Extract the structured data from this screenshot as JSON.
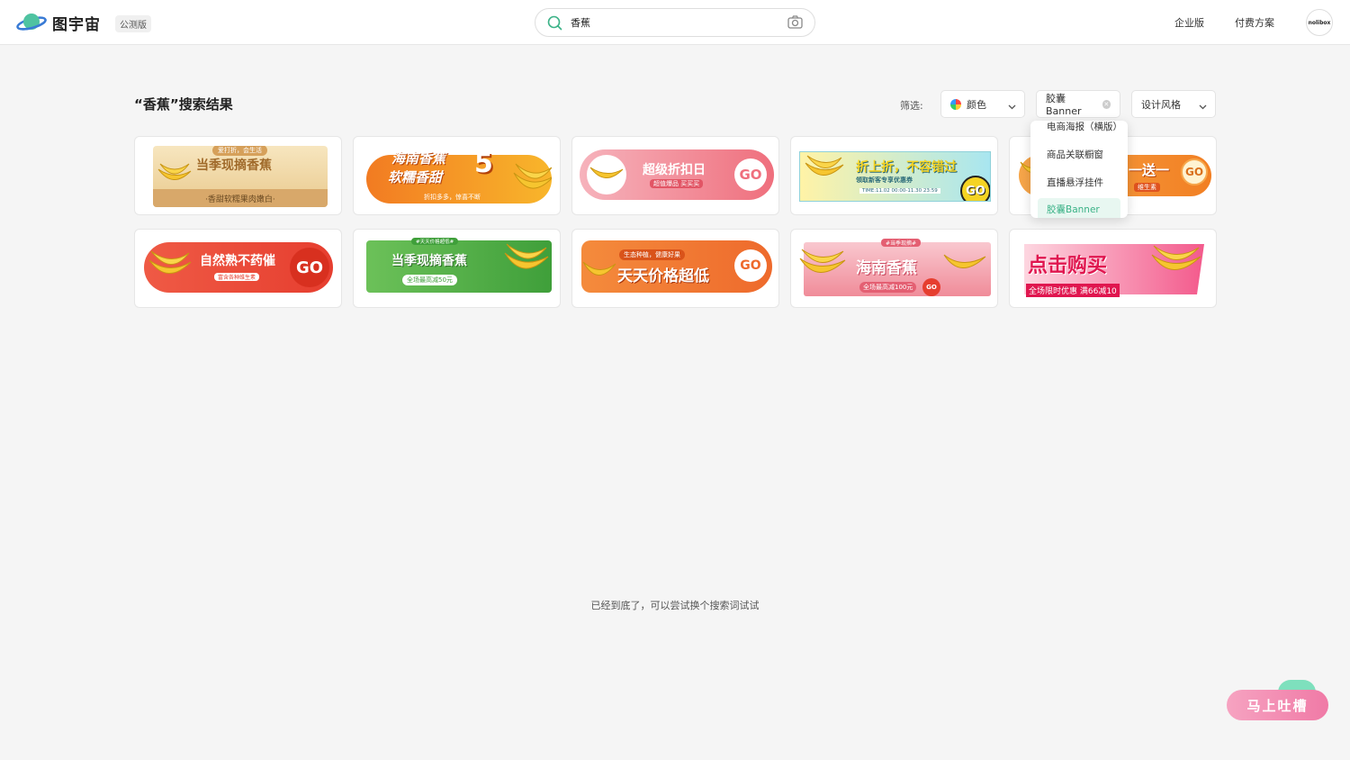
{
  "header": {
    "logo_text": "图宇宙",
    "beta_badge": "公测版",
    "search_value": "香蕉",
    "nav_enterprise": "企业版",
    "nav_pricing": "付费方案",
    "avatar_text": "nolibox"
  },
  "results": {
    "title": "“香蕉”搜索结果",
    "filter_label": "筛选:",
    "filter_color": "颜色",
    "filter_type": "胶囊Banner",
    "filter_style": "设计风格",
    "dropdown_items": [
      "电商海报（横版）",
      "商品关联橱窗",
      "直播悬浮挂件",
      "胶囊Banner"
    ],
    "dropdown_selected": "胶囊Banner",
    "bottom_message": "已经到底了，可以尝试换个搜索词试试"
  },
  "cards": [
    {
      "title": "当季现摘香蕉",
      "sub": "·香甜软糯果肉嫩白·",
      "tag": "爱打折，会生活"
    },
    {
      "title": "海南香蕉",
      "title2": "软糯香甜",
      "num": "5",
      "sub": "折扣多多，惊喜不断"
    },
    {
      "title": "超级折扣日",
      "sub": "超值爆品 买买买",
      "go": "GO"
    },
    {
      "title": "折上折，不容错过",
      "sub": "领取新客专享优惠券",
      "time": "TIME:11.02 00:00-11.30 23:59",
      "go": "GO"
    },
    {
      "title": "一送一",
      "sub": "维生素",
      "go": "GO"
    },
    {
      "title": "自然熟不药催",
      "sub": "富含各种维生素",
      "go": "GO"
    },
    {
      "title": "当季现摘香蕉",
      "sub": "全场最高减50元",
      "tag": "#天天价格超低#"
    },
    {
      "title": "天天价格超低",
      "sub": "生态种植，健康好果",
      "go": "GO"
    },
    {
      "title": "海南香蕉",
      "sub": "全场最高减100元",
      "tag": "#当季现摘#",
      "go": "GO"
    },
    {
      "title": "点击购买",
      "sub": "全场限时优惠 满66减10"
    }
  ],
  "feedback": {
    "label": "马上吐槽"
  }
}
